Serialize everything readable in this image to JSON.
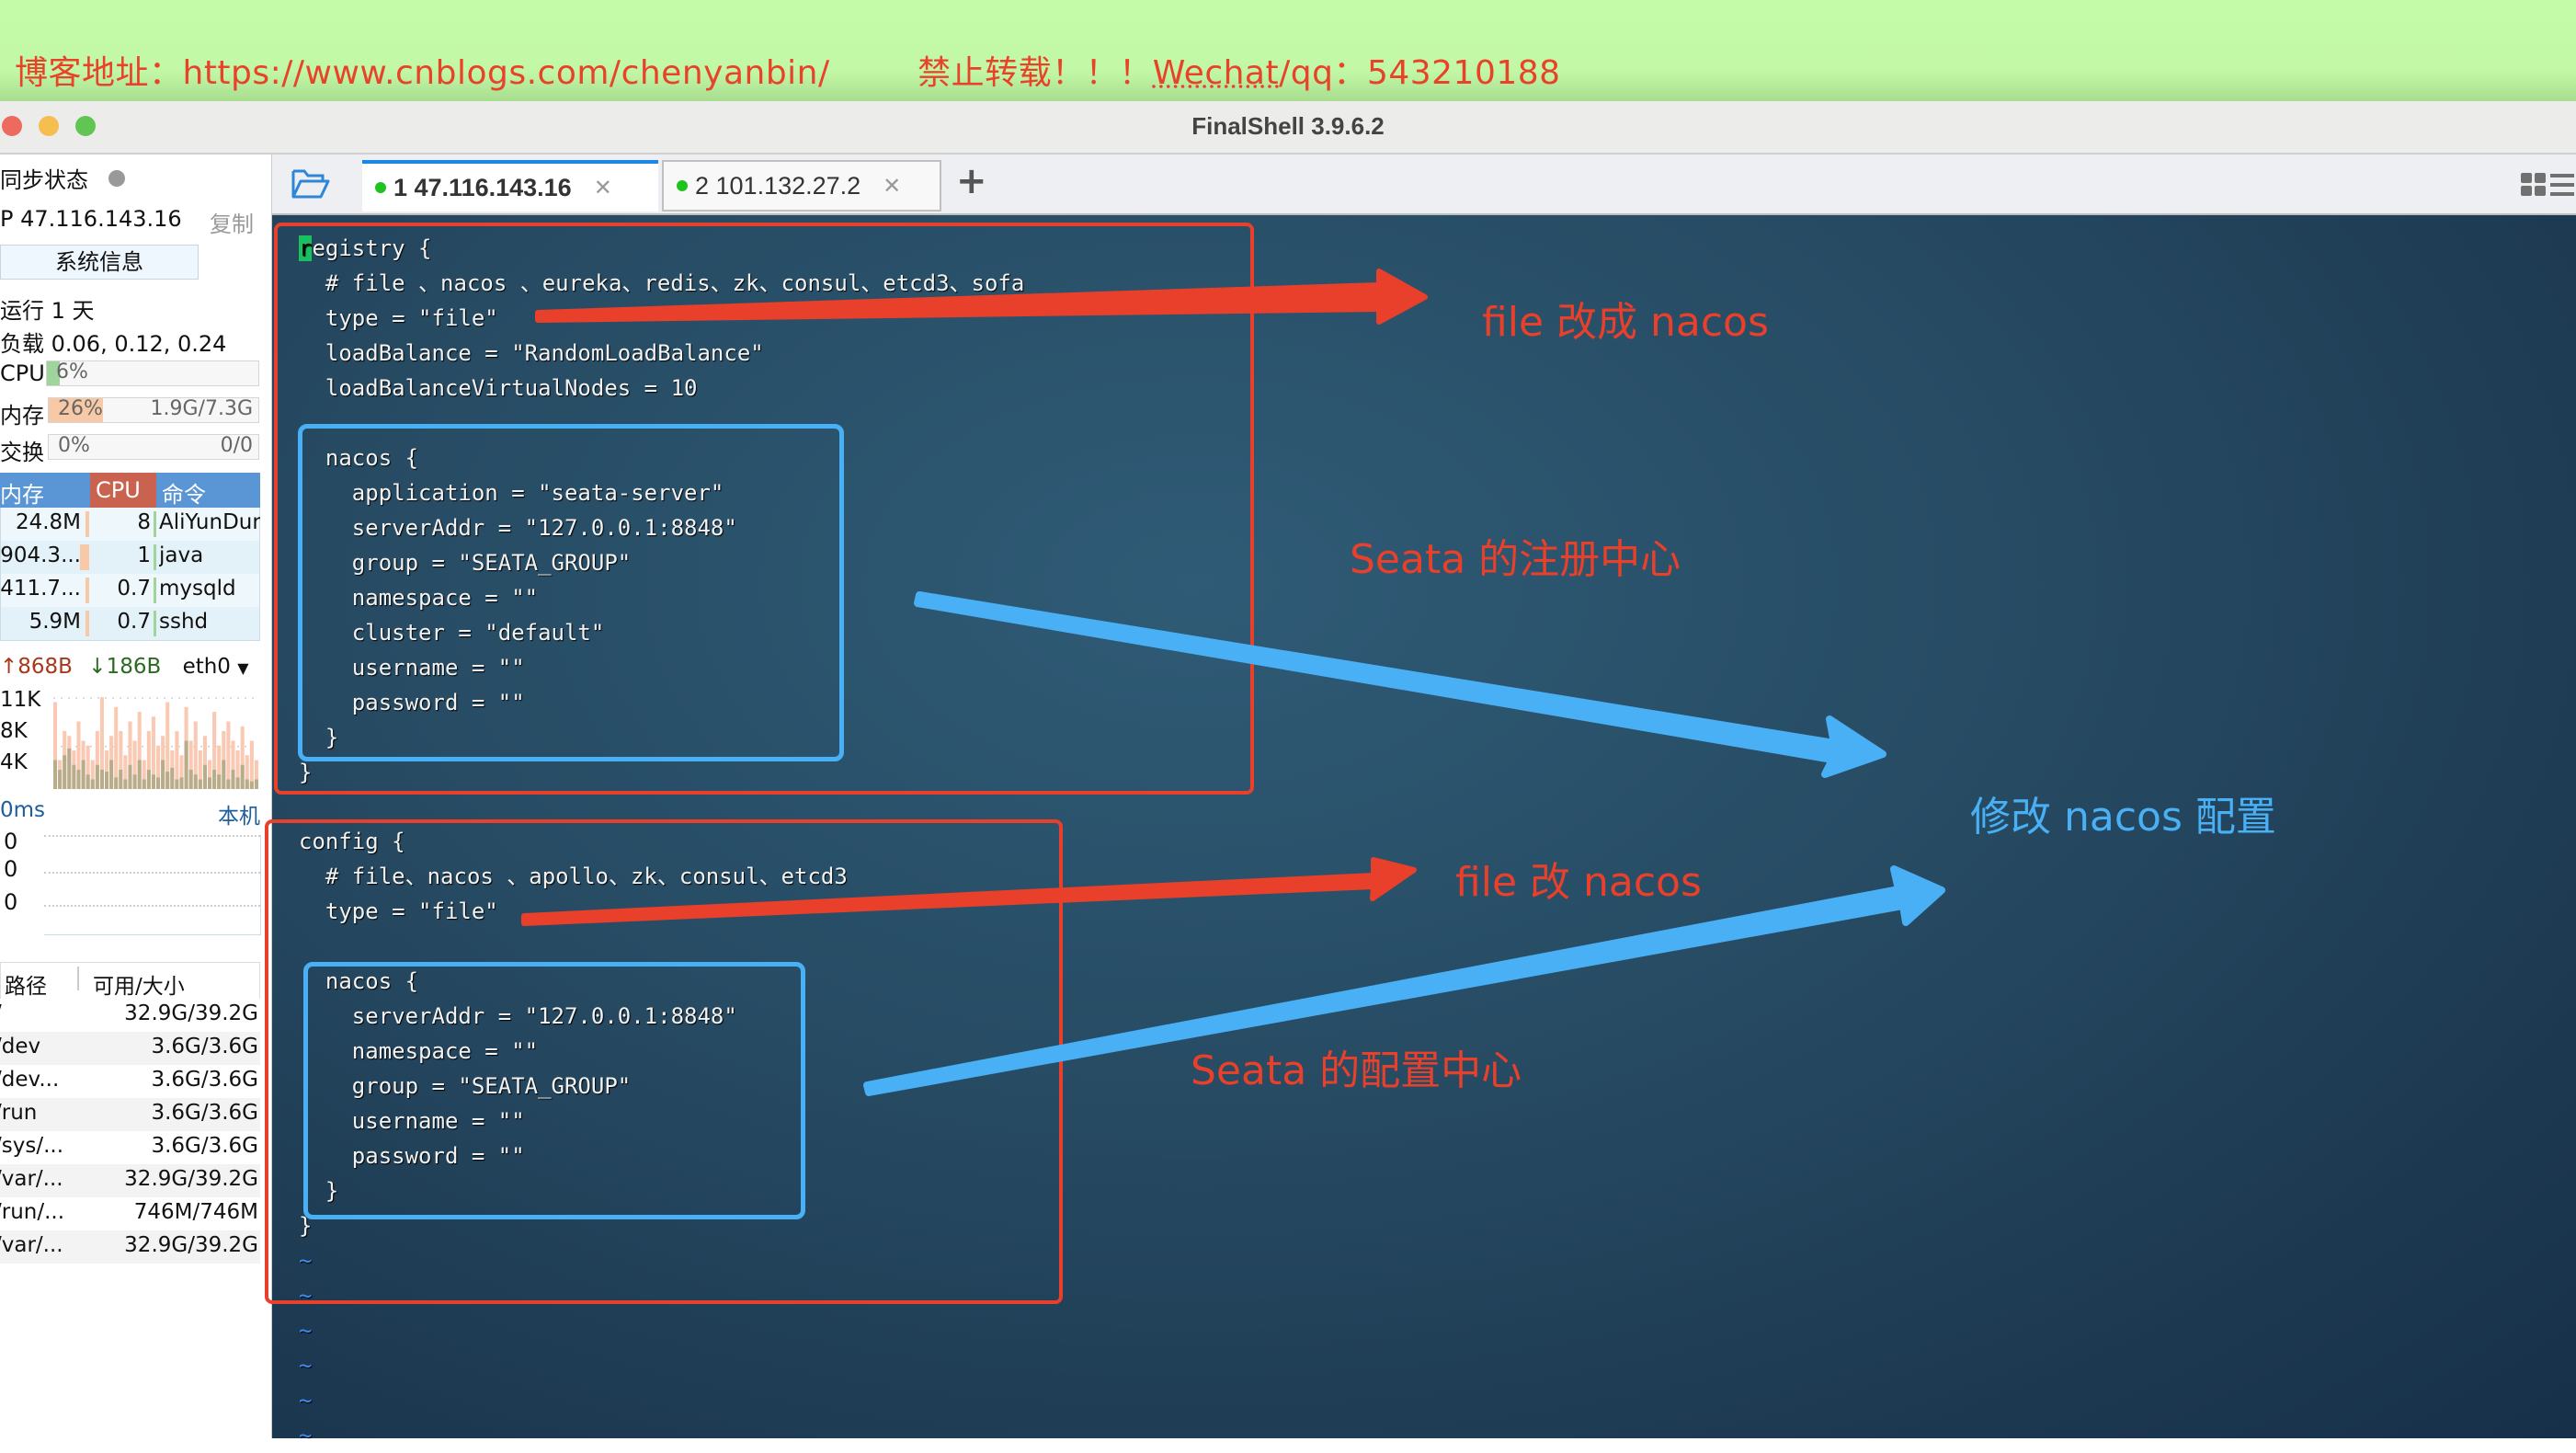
{
  "banner": {
    "blog_label": "博客地址：https://www.cnblogs.com/chenyanbin/",
    "notice_prefix": "禁止转载！！！",
    "notice_contact": "Wechat",
    "notice_suffix": "/qq：543210188"
  },
  "window": {
    "title": "FinalShell 3.9.6.2"
  },
  "tabs": [
    {
      "label": "1 47.116.143.16",
      "active": true,
      "status": "connected"
    },
    {
      "label": "2 101.132.27.2",
      "active": false,
      "status": "connected"
    }
  ],
  "tabbar": {
    "add_label": "+",
    "folder_icon": "folder-open-icon",
    "layout_icon": "grid-list-icon"
  },
  "sidebar": {
    "sync_label": "同步状态",
    "ip": "P 47.116.143.16",
    "copy_label": "复制",
    "sysinfo_button": "系统信息",
    "uptime": "运行 1 天",
    "load": "负载 0.06, 0.12, 0.24",
    "cpu": {
      "label": "CPU",
      "text": "6%",
      "percent": 6
    },
    "mem": {
      "label": "内存",
      "text": "26%",
      "percent": 26,
      "usage": "1.9G/7.3G"
    },
    "swap": {
      "label": "交换",
      "text": "0%",
      "percent": 0,
      "usage": "0/0"
    },
    "proc_headers": [
      "内存",
      "CPU",
      "命令"
    ],
    "processes": [
      {
        "mem": "24.8M",
        "cpu": "8",
        "cmd": "AliYunDun"
      },
      {
        "mem": "904.3...",
        "cpu": "1",
        "cmd": "java"
      },
      {
        "mem": "411.7...",
        "cpu": "0.7",
        "cmd": "mysqld"
      },
      {
        "mem": "5.9M",
        "cpu": "0.7",
        "cmd": "sshd"
      }
    ],
    "net": {
      "up": "868B",
      "down": "186B",
      "iface": "eth0",
      "y_ticks": [
        "11K",
        "8K",
        "4K"
      ]
    },
    "ping": {
      "latency": "0ms",
      "target": "本机",
      "values": [
        "0",
        "0",
        "0"
      ]
    },
    "disk_headers": [
      "路径",
      "可用/大小"
    ],
    "disks": [
      {
        "path": "/",
        "usage": "32.9G/39.2G"
      },
      {
        "path": "/dev",
        "usage": "3.6G/3.6G"
      },
      {
        "path": "/dev...",
        "usage": "3.6G/3.6G"
      },
      {
        "path": "/run",
        "usage": "3.6G/3.6G"
      },
      {
        "path": "/sys/...",
        "usage": "3.6G/3.6G"
      },
      {
        "path": "/var/...",
        "usage": "32.9G/39.2G"
      },
      {
        "path": "/run/...",
        "usage": "746M/746M"
      },
      {
        "path": "/var/...",
        "usage": "32.9G/39.2G"
      }
    ]
  },
  "terminal": {
    "registry_lines": [
      "registry {",
      "  # file 、nacos 、eureka、redis、zk、consul、etcd3、sofa",
      "  type = \"file\"",
      "  loadBalance = \"RandomLoadBalance\"",
      "  loadBalanceVirtualNodes = 10",
      "",
      "  nacos {",
      "    application = \"seata-server\"",
      "    serverAddr = \"127.0.0.1:8848\"",
      "    group = \"SEATA_GROUP\"",
      "    namespace = \"\"",
      "    cluster = \"default\"",
      "    username = \"\"",
      "    password = \"\"",
      "  }",
      "}"
    ],
    "config_lines": [
      "config {",
      "  # file、nacos 、apollo、zk、consul、etcd3",
      "  type = \"file\"",
      "",
      "  nacos {",
      "    serverAddr = \"127.0.0.1:8848\"",
      "    namespace = \"\"",
      "    group = \"SEATA_GROUP\"",
      "    username = \"\"",
      "    password = \"\"",
      "  }",
      "}"
    ],
    "tilde_lines": [
      "~",
      "~",
      "~",
      "~",
      "~",
      "~"
    ]
  },
  "annotations": {
    "registry_type_note": "file 改成 nacos",
    "registry_center_note": "Seata 的注册中心",
    "modify_nacos_note": "修改 nacos 配置",
    "config_type_note": "file 改 nacos",
    "config_center_note": "Seata 的配置中心",
    "red": "#e8402a",
    "blue": "#4ab0f5"
  }
}
